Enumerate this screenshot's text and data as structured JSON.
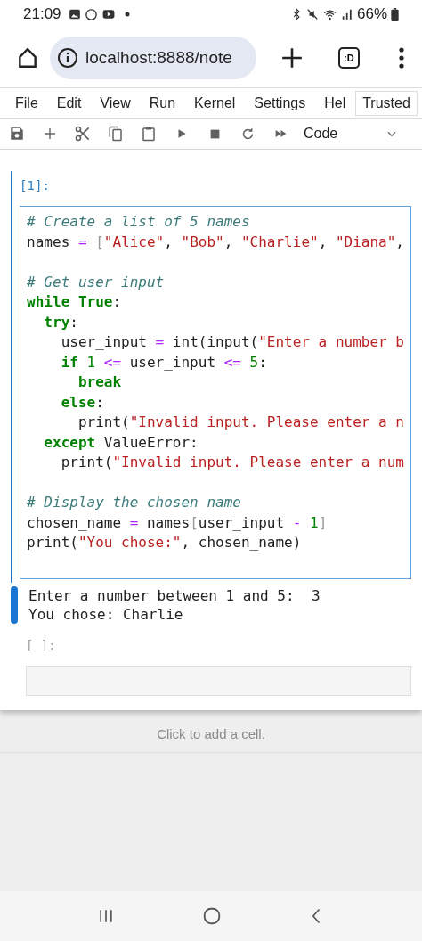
{
  "status_bar": {
    "time": "21:09",
    "battery": "66%"
  },
  "browser": {
    "url": "localhost:8888/note",
    "tabs_label": ":D"
  },
  "menu": [
    {
      "label": "File"
    },
    {
      "label": "Edit"
    },
    {
      "label": "View"
    },
    {
      "label": "Run"
    },
    {
      "label": "Kernel"
    },
    {
      "label": "Settings"
    },
    {
      "label": "Hel"
    }
  ],
  "trusted": "Trusted",
  "toolbar": {
    "cell_type": "Code"
  },
  "cells": [
    {
      "prompt": "[1]:",
      "active": true,
      "blocks": [
        [
          [
            {
              "kind": "comment",
              "text": "# Create a list of 5 names"
            }
          ],
          [
            {
              "kind": "plain",
              "text": "names"
            },
            {
              "kind": "operator",
              "text": " = "
            },
            {
              "kind": "bracket",
              "text": "["
            },
            {
              "kind": "string",
              "text": "\"Alice\""
            },
            {
              "kind": "plain",
              "text": ", "
            },
            {
              "kind": "string",
              "text": "\"Bob\""
            },
            {
              "kind": "plain",
              "text": ", "
            },
            {
              "kind": "string",
              "text": "\"Charlie\""
            },
            {
              "kind": "plain",
              "text": ", "
            },
            {
              "kind": "string",
              "text": "\"Diana\""
            },
            {
              "kind": "plain",
              "text": ","
            }
          ]
        ],
        [
          [
            {
              "kind": "comment",
              "text": "# Get user input"
            }
          ],
          [
            {
              "kind": "keyword",
              "text": "while True"
            },
            {
              "kind": "plain",
              "text": ":"
            }
          ],
          [
            {
              "kind": "keyword",
              "text": "  try"
            },
            {
              "kind": "plain",
              "text": ":"
            }
          ],
          [
            {
              "kind": "plain",
              "text": "    user_input"
            },
            {
              "kind": "operator",
              "text": " = "
            },
            {
              "kind": "plain",
              "text": "int(input("
            },
            {
              "kind": "string",
              "text": "\"Enter a number b"
            }
          ],
          [
            {
              "kind": "keyword",
              "text": "    if"
            },
            {
              "kind": "number",
              "text": " 1"
            },
            {
              "kind": "operator",
              "text": " <= "
            },
            {
              "kind": "plain",
              "text": "user_input"
            },
            {
              "kind": "operator",
              "text": " <= "
            },
            {
              "kind": "number",
              "text": "5"
            },
            {
              "kind": "plain",
              "text": ":"
            }
          ],
          [
            {
              "kind": "keyword",
              "text": "      break"
            }
          ],
          [
            {
              "kind": "keyword",
              "text": "    else"
            },
            {
              "kind": "plain",
              "text": ":"
            }
          ],
          [
            {
              "kind": "plain",
              "text": "      print("
            },
            {
              "kind": "string",
              "text": "\"Invalid input. Please enter a n"
            }
          ],
          [
            {
              "kind": "keyword",
              "text": "  except"
            },
            {
              "kind": "plain",
              "text": " ValueError:"
            }
          ],
          [
            {
              "kind": "plain",
              "text": "    print("
            },
            {
              "kind": "string",
              "text": "\"Invalid input. Please enter a num"
            }
          ]
        ],
        [
          [
            {
              "kind": "comment",
              "text": "# Display the chosen name"
            }
          ],
          [
            {
              "kind": "plain",
              "text": "chosen_name"
            },
            {
              "kind": "operator",
              "text": " = "
            },
            {
              "kind": "plain",
              "text": "names"
            },
            {
              "kind": "bracket",
              "text": "["
            },
            {
              "kind": "plain",
              "text": "user_input"
            },
            {
              "kind": "operator",
              "text": " - "
            },
            {
              "kind": "number",
              "text": "1"
            },
            {
              "kind": "bracket",
              "text": "]"
            }
          ],
          [
            {
              "kind": "plain",
              "text": "print("
            },
            {
              "kind": "string",
              "text": "\"You chose:\""
            },
            {
              "kind": "plain",
              "text": ", chosen_name)"
            }
          ]
        ]
      ],
      "output": [
        "Enter a number between 1 and 5:  3",
        "You chose: Charlie"
      ]
    },
    {
      "prompt": "[ ]:",
      "active": false
    }
  ],
  "add_cell": "Click to add a cell."
}
